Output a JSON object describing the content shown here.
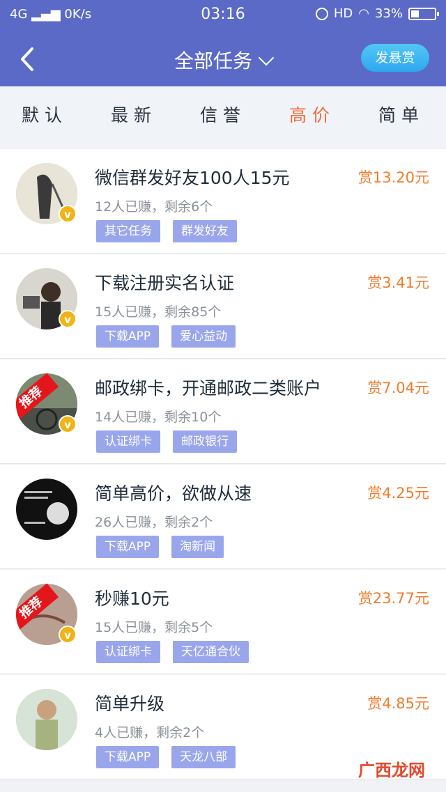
{
  "status": {
    "network": "4G",
    "speed": "0K/s",
    "time": "03:16",
    "hd": "HD",
    "battery": "33%",
    "battery_level": 0.33
  },
  "header": {
    "title": "全部任务",
    "post_button": "发悬赏"
  },
  "tabs": [
    {
      "label": "默认",
      "active": false
    },
    {
      "label": "最新",
      "active": false
    },
    {
      "label": "信誉",
      "active": false
    },
    {
      "label": "高价",
      "active": true
    },
    {
      "label": "简单",
      "active": false
    }
  ],
  "tasks": [
    {
      "title": "微信群发好友100人15元",
      "meta": "12人已赚，剩余6个",
      "reward": "赏13.20元",
      "tags": [
        "其它任务",
        "群发好友"
      ],
      "badge": "v",
      "ribbon": ""
    },
    {
      "title": "下载注册实名认证",
      "meta": "15人已赚，剩余85个",
      "reward": "赏3.41元",
      "tags": [
        "下载APP",
        "爱心益动"
      ],
      "badge": "v",
      "ribbon": ""
    },
    {
      "title": "邮政绑卡，开通邮政二类账户",
      "meta": "14人已赚，剩余10个",
      "reward": "赏7.04元",
      "tags": [
        "认证绑卡",
        "邮政银行"
      ],
      "badge": "v",
      "ribbon": "推荐"
    },
    {
      "title": "简单高价，欲做从速",
      "meta": "26人已赚，剩余2个",
      "reward": "赏4.25元",
      "tags": [
        "下载APP",
        "淘新闻"
      ],
      "badge": "",
      "ribbon": ""
    },
    {
      "title": "秒赚10元",
      "meta": "15人已赚，剩余5个",
      "reward": "赏23.77元",
      "tags": [
        "认证绑卡",
        "天亿通合伙"
      ],
      "badge": "v",
      "ribbon": "推荐"
    },
    {
      "title": "简单升级",
      "meta": "4人已赚，剩余2个",
      "reward": "赏4.85元",
      "tags": [
        "下载APP",
        "天龙八部"
      ],
      "badge": "",
      "ribbon": ""
    }
  ],
  "watermark": "广西龙网",
  "colors": {
    "header": "#5b6ac7",
    "accent": "#f06b3b",
    "tag": "#9aa6ec",
    "reward": "#ef7b2b"
  }
}
